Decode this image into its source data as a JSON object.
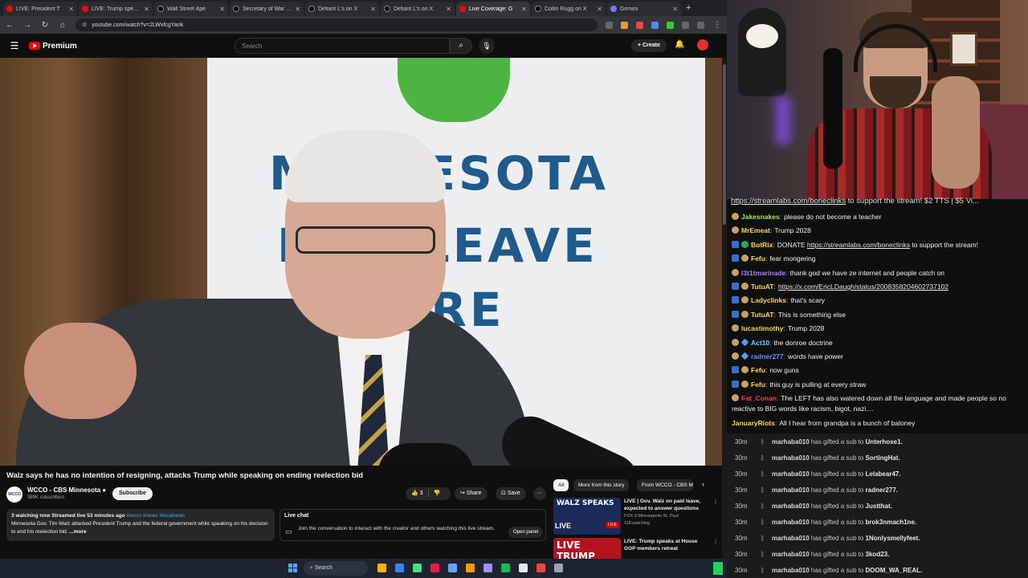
{
  "browser": {
    "tabs": [
      {
        "title": "LIVE: President T",
        "icon": "yt"
      },
      {
        "title": "LIVE: Trump speaks",
        "icon": "yt"
      },
      {
        "title": "Wall Street Ape",
        "icon": "x"
      },
      {
        "title": "Secretary of War Pe",
        "icon": "x"
      },
      {
        "title": "Defiant L's on X",
        "icon": "x"
      },
      {
        "title": "Defiant L's on X",
        "icon": "x"
      },
      {
        "title": "Live Coverage: G",
        "icon": "yt"
      },
      {
        "title": "Collin Rugg on X",
        "icon": "x"
      },
      {
        "title": "Gemini",
        "icon": "gem"
      }
    ],
    "active_tab": 6,
    "url": "youtube.com/watch?v=2LWxfcgYank"
  },
  "youtube": {
    "logo_text": "Premium",
    "search_placeholder": "Search",
    "create_label": "Create",
    "video_banner": [
      "MINNESOTA",
      "HAD LEAVE",
      "HERE"
    ],
    "title": "Walz says he has no intention of resigning, attacks Trump while speaking on ending reelection bid",
    "channel": {
      "name": "WCCO - CBS Minnesota",
      "subscribers": "389K subscribers",
      "avatar_text": "WCCO"
    },
    "subscribe_label": "Subscribe",
    "likes": "3",
    "share_label": "Share",
    "save_label": "Save",
    "description": {
      "meta": "3 watching now  Streamed live 53 minutes ago",
      "tags": "#wcco #news #localnews",
      "text": "Minnesota Gov. Tim Walz attacked President Trump and the federal government while speaking on his decision to end his reelection bid.",
      "more": "...more"
    },
    "live_chat": {
      "heading": "Live chat",
      "text": "Join the conversation to interact with the creator and others watching this live stream.",
      "button": "Open panel"
    },
    "chips": [
      "All",
      "More from this story",
      "From WCCO - CBS Minnesota"
    ],
    "related": [
      {
        "thumb_text": "WALZ SPEAKS",
        "badge": "LIVE",
        "title": "LIVE | Gov. Walz on paid leave, expected to answer questions",
        "channel": "FOX 9 Minneapolis-St. Paul",
        "watching": "118 watching"
      },
      {
        "thumb_text": "LIVE TRUMP",
        "badge": "",
        "title": "LIVE: Trump speaks at House GOP members retreat",
        "channel": "",
        "watching": ""
      }
    ]
  },
  "stream": {
    "donate_prefix": "",
    "donate_link": "https://streamlabs.com/boneclinks",
    "donate_suffix": " to support the stream! $2 TTS | $5 Vi..."
  },
  "chat": [
    {
      "user": "Jakesnakes",
      "color": "#a8e070",
      "badges": [
        "em"
      ],
      "text": "please do not become a teacher",
      "link": ""
    },
    {
      "user": "MrEmeat",
      "color": "#ffd54a",
      "badges": [
        "em"
      ],
      "text": "Trump 2028",
      "link": ""
    },
    {
      "user": "BotRix",
      "color": "#ffd54a",
      "badges": [
        "tw",
        "sub"
      ],
      "text": "DONATE ",
      "link": "https://streamlabs.com/boneclinks",
      "after": " to support the stream!"
    },
    {
      "user": "Fefu",
      "color": "#ffd54a",
      "badges": [
        "tw",
        "em"
      ],
      "text": "fear mongering",
      "link": ""
    },
    {
      "user": "l3t1tmarinade",
      "color": "#b27bff",
      "badges": [
        "em"
      ],
      "text": "thank god we have ze internet and people catch on",
      "link": ""
    },
    {
      "user": "TutuAT",
      "color": "#ffd54a",
      "badges": [
        "tw",
        "em"
      ],
      "text": "",
      "link": "https://x.com/EricLDaugh/status/2008358204602737102"
    },
    {
      "user": "Ladyclinks",
      "color": "#ffd54a",
      "badges": [
        "tw",
        "em"
      ],
      "text": "that's scary",
      "link": ""
    },
    {
      "user": "TutuAT",
      "color": "#ffd54a",
      "badges": [
        "tw",
        "em"
      ],
      "text": "This is something else",
      "link": ""
    },
    {
      "user": "lucastimothy",
      "color": "#ffd54a",
      "badges": [
        "em"
      ],
      "text": "Trump 2028",
      "link": ""
    },
    {
      "user": "Act10",
      "color": "#5fd0ff",
      "badges": [
        "em",
        "dia"
      ],
      "text": "the donroe doctrine",
      "link": ""
    },
    {
      "user": "radner277",
      "color": "#6a8cff",
      "badges": [
        "em",
        "dia"
      ],
      "text": "words have power",
      "link": ""
    },
    {
      "user": "Fefu",
      "color": "#ffd54a",
      "badges": [
        "tw",
        "em"
      ],
      "text": "now guns",
      "link": ""
    },
    {
      "user": "Fefu",
      "color": "#ffd54a",
      "badges": [
        "tw",
        "em"
      ],
      "text": "this guy is pulling at every straw",
      "link": ""
    },
    {
      "user": "Fat_Conan",
      "color": "#ff3b3b",
      "badges": [
        "em"
      ],
      "text": "The LEFT has also watered down all the language and made people so no",
      "link": ""
    },
    {
      "user": "",
      "color": "#f1f1f1",
      "badges": [],
      "text": "reactive to BIG words like racism, bigot, nazi....",
      "link": ""
    },
    {
      "user": "JanuaryRiots",
      "color": "#ffd54a",
      "badges": [],
      "text": "All I hear from grandpa is a bunch of baloney",
      "link": ""
    }
  ],
  "gifts": [
    {
      "time": "30m",
      "user": "marhaba010",
      "action": " has gifted a sub to ",
      "recipient": "Unterhose1."
    },
    {
      "time": "30m",
      "user": "marhaba010",
      "action": " has gifted a sub to ",
      "recipient": "SortingHat."
    },
    {
      "time": "30m",
      "user": "marhaba010",
      "action": " has gifted a sub to ",
      "recipient": "Lelabear47."
    },
    {
      "time": "30m",
      "user": "marhaba010",
      "action": " has gifted a sub to ",
      "recipient": "radner277."
    },
    {
      "time": "30m",
      "user": "marhaba010",
      "action": " has gifted a sub to ",
      "recipient": "Justthat."
    },
    {
      "time": "30m",
      "user": "marhaba010",
      "action": " has gifted a sub to ",
      "recipient": "brok3nmach1ne."
    },
    {
      "time": "30m",
      "user": "marhaba010",
      "action": " has gifted a sub to ",
      "recipient": "1Nonlysmellyfeet."
    },
    {
      "time": "30m",
      "user": "marhaba010",
      "action": " has gifted a sub to ",
      "recipient": "3kod23."
    },
    {
      "time": "30m",
      "user": "marhaba010",
      "action": " has gifted a sub to ",
      "recipient": "DOOM_WA_REAL."
    }
  ],
  "taskbar": {
    "search_label": "Search",
    "icon_colors": [
      "#ffb400",
      "#3b82f6",
      "#4ade80",
      "#e11d48",
      "#60a5fa",
      "#f59e0b",
      "#a78bfa",
      "#1db954",
      "#e5e7eb",
      "#ef4444",
      "#9ca3af"
    ]
  }
}
